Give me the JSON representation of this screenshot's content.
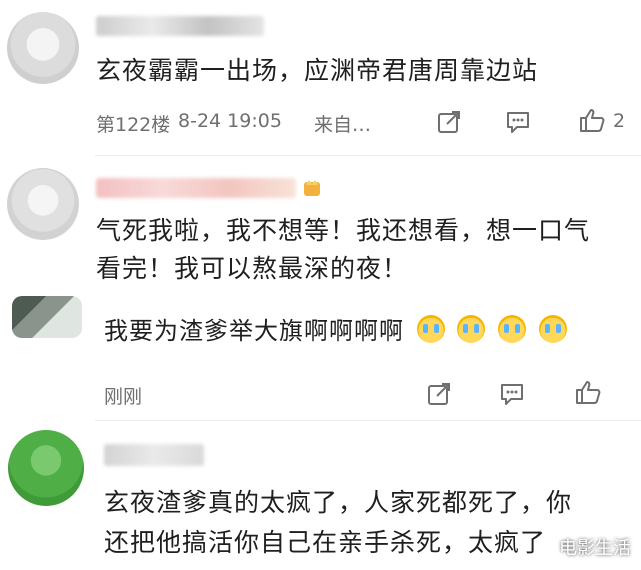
{
  "comments": [
    {
      "text_lines": [
        "玄夜霸霸一出场，应渊帝君唐周靠边站"
      ],
      "floor": "第122楼",
      "datetime": "8-24 19:05",
      "source": "来自…",
      "likes": "2"
    },
    {
      "text_lines": [
        "气死我啦，我不想等！我还想看，想一口气",
        "看完！我可以熬最深的夜！"
      ]
    },
    {
      "text_lines": [
        "我要为渣爹举大旗啊啊啊啊"
      ],
      "emoji_count": 4,
      "time": "刚刚"
    },
    {
      "text_lines": [
        "玄夜渣爹真的太疯了，人家死都死了，你",
        "还把他搞活你自己在亲手杀死，太疯了"
      ]
    }
  ],
  "watermark": "电影生活",
  "icons": [
    "share-icon",
    "comment-icon",
    "thumbs-up-icon",
    "vip-crown-icon"
  ]
}
